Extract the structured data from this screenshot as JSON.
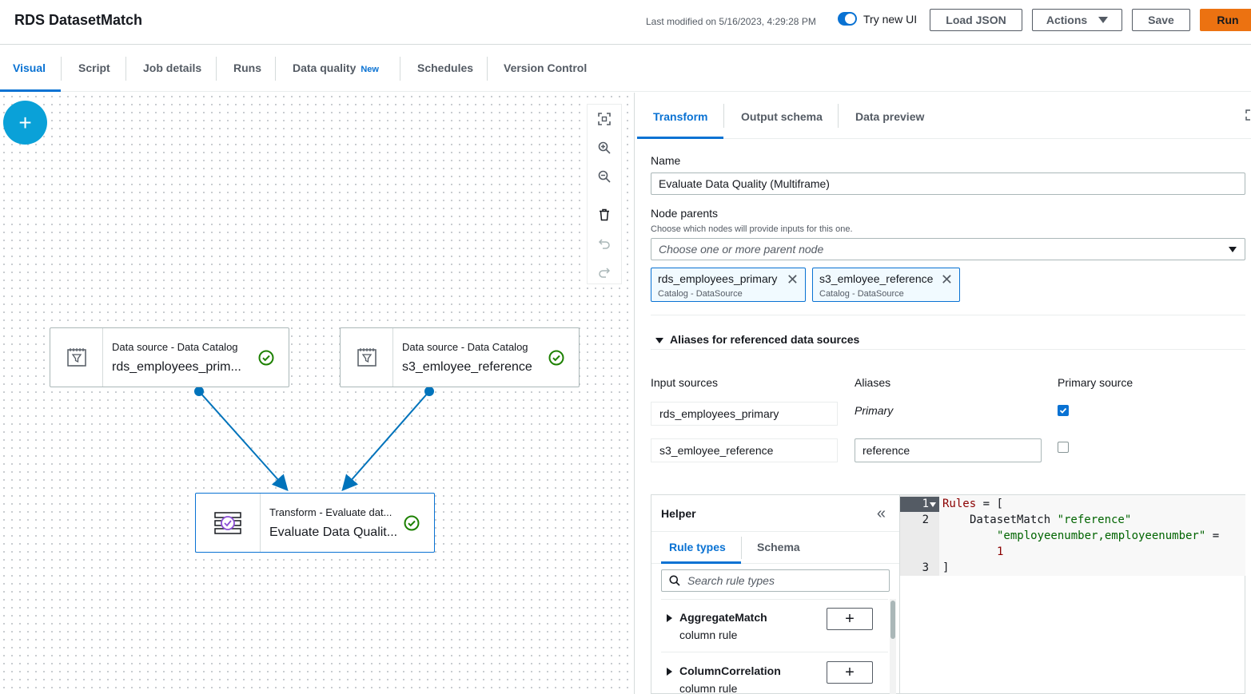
{
  "header": {
    "title": "RDS DatasetMatch",
    "last_modified": "Last modified on 5/16/2023, 4:29:28 PM",
    "toggle_label": "Try new UI",
    "load_json": "Load JSON",
    "actions": "Actions",
    "save": "Save",
    "run": "Run"
  },
  "tabs": [
    {
      "label": "Visual"
    },
    {
      "label": "Script"
    },
    {
      "label": "Job details"
    },
    {
      "label": "Runs"
    },
    {
      "label": "Data quality",
      "badge": "New"
    },
    {
      "label": "Schedules"
    },
    {
      "label": "Version Control"
    }
  ],
  "canvas": {
    "add_label": "+",
    "nodes": [
      {
        "type": "Data source - Data Catalog",
        "name": "rds_employees_prim..."
      },
      {
        "type": "Data source - Data Catalog",
        "name": "s3_emloyee_reference"
      },
      {
        "type": "Transform - Evaluate dat...",
        "name": "Evaluate Data Qualit..."
      }
    ]
  },
  "panel": {
    "tabs": [
      "Transform",
      "Output schema",
      "Data preview"
    ],
    "name_label": "Name",
    "name_value": "Evaluate Data Quality (Multiframe)",
    "parents_label": "Node parents",
    "parents_desc": "Choose which nodes will provide inputs for this one.",
    "parents_placeholder": "Choose one or more parent node",
    "tokens": [
      {
        "name": "rds_employees_primary",
        "sub": "Catalog - DataSource"
      },
      {
        "name": "s3_emloyee_reference",
        "sub": "Catalog - DataSource"
      }
    ],
    "aliases_title": "Aliases for referenced data sources",
    "col_input": "Input sources",
    "col_alias": "Aliases",
    "col_primary": "Primary source",
    "rows": [
      {
        "input": "rds_employees_primary",
        "alias": "Primary",
        "primary": true
      },
      {
        "input": "s3_emloyee_reference",
        "alias": "reference",
        "primary": false
      }
    ]
  },
  "helper": {
    "title": "Helper",
    "tabs": [
      "Rule types",
      "Schema"
    ],
    "search_placeholder": "Search rule types",
    "rules": [
      {
        "name": "AggregateMatch",
        "sub": "column rule"
      },
      {
        "name": "ColumnCorrelation",
        "sub": "column rule"
      }
    ]
  },
  "editor": {
    "line_numbers": [
      "1",
      "2",
      "3"
    ],
    "tokens": {
      "rules_kw": "Rules",
      "eq_open": " = [",
      "dataset_match": "DatasetMatch ",
      "ref_str": "\"reference\"",
      "cols_str": "\"employeenumber,employeenumber\"",
      "eq": " =",
      "one": "1",
      "close": "]"
    }
  }
}
